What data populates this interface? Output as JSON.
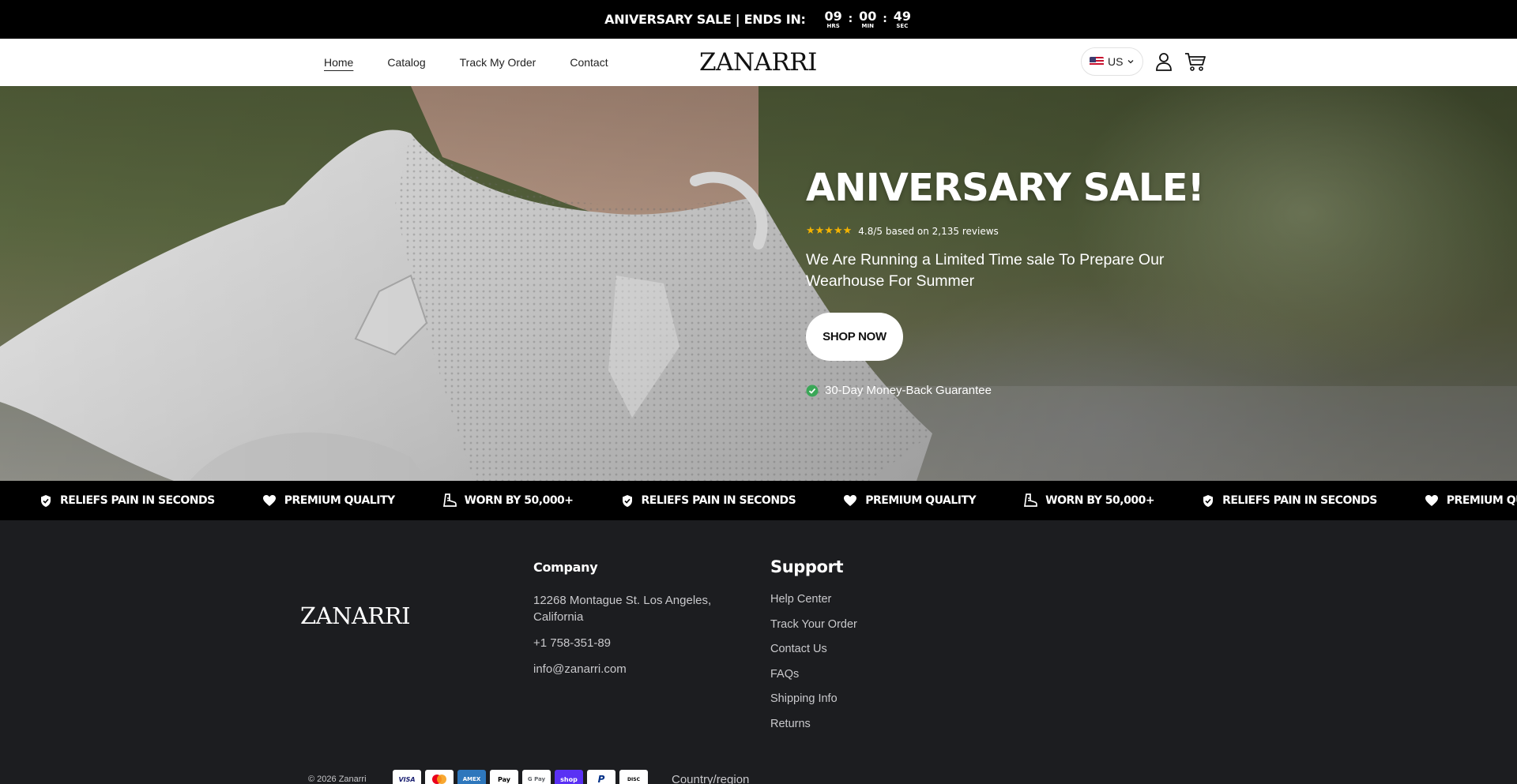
{
  "announcement": {
    "text": "ANIVERSARY SALE | ENDS IN:",
    "timer": [
      {
        "value": "09",
        "label": "HRS"
      },
      {
        "value": "00",
        "label": "MIN"
      },
      {
        "value": "49",
        "label": "SEC"
      }
    ],
    "separator": ":"
  },
  "header": {
    "nav": [
      "Home",
      "Catalog",
      "Track My Order",
      "Contact"
    ],
    "logo": "ZANARRI",
    "locale": "US"
  },
  "hero": {
    "title": "ANIVERSARY SALE!",
    "stars": "★★★★★",
    "rating_text": "4.8/5 based on 2,135 reviews",
    "subtitle": "We Are Running a Limited Time sale To Prepare Our Wearhouse For Summer",
    "cta": "SHOP NOW",
    "guarantee": "30-Day Money-Back Guarantee"
  },
  "marquee": {
    "items": [
      {
        "icon": "shield-icon",
        "text": "RELIEFS PAIN IN SECONDS"
      },
      {
        "icon": "heart-icon",
        "text": "PREMIUM QUALITY"
      },
      {
        "icon": "boot-icon",
        "text": "WORN BY 50,000+"
      },
      {
        "icon": "shield-icon",
        "text": "RELIEFS PAIN IN SECONDS"
      },
      {
        "icon": "heart-icon",
        "text": "PREMIUM QUALITY"
      },
      {
        "icon": "boot-icon",
        "text": "WORN BY 50,000+"
      },
      {
        "icon": "shield-icon",
        "text": "RELIEFS PAIN IN SECONDS"
      },
      {
        "icon": "heart-icon",
        "text": "PREMIUM QUALITY"
      }
    ]
  },
  "footer": {
    "logo": "ZANARRI",
    "company": {
      "title": "Company",
      "address": "12268 Montague St. Los Angeles, California",
      "phone": "+1 758-351-89",
      "email": "info@zanarri.com"
    },
    "support": {
      "title": "Support",
      "links": [
        "Help Center",
        "Track Your Order",
        "Contact Us",
        "FAQs",
        "Shipping Info",
        "Returns"
      ]
    },
    "copyright": "© 2026 Zanarri",
    "payments": [
      "VISA",
      "MC",
      "AMEX",
      "Pay",
      "G Pay",
      "shop",
      "P",
      "DISC"
    ],
    "country_label": "Country/region"
  },
  "colors": {
    "announcement_bg": "#000000",
    "footer_bg": "#1c1d20",
    "star": "#f5b300",
    "check": "#3aa757"
  }
}
